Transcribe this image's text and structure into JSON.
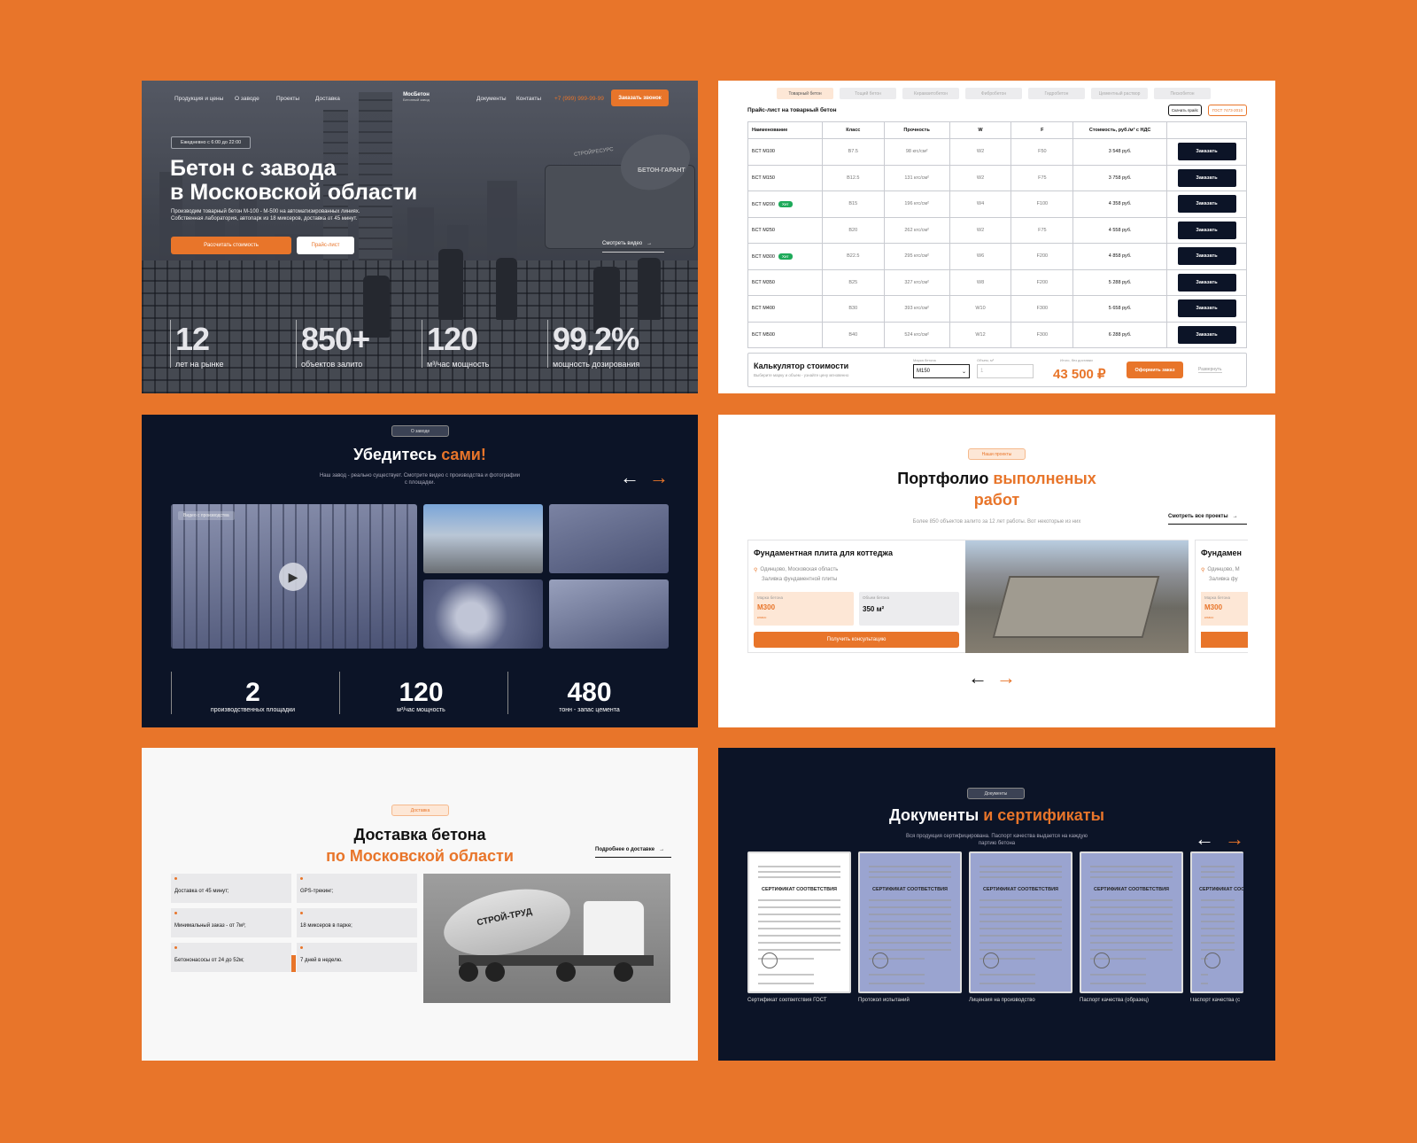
{
  "hero": {
    "nav": [
      "Продукция и цены",
      "О заводе",
      "Проекты",
      "Доставка",
      "Документы",
      "Контакты"
    ],
    "logo": "МосБетон",
    "logo_sub": "Бетонный завод",
    "phone": "+7 (999) 999-99-99",
    "callback": "Заказать звонок",
    "hours": "Ежедневно с 6:00 до 22:00",
    "title1": "Бетон с завода",
    "title2": "в Московской области",
    "desc1": "Производим товарный бетон М-100 - М-500 на автоматизированных линиях.",
    "desc2": "Собственная лаборатория, автопарк из 18 миксеров, доставка от 45 минут.",
    "btn_calc": "Рассчитать стоимость",
    "btn_price": "Прайс-лист",
    "video": "Смотреть видео",
    "truck_brand": "БЕТОН-ГАРАНТ",
    "truck_brand2": "СТРОЙРЕСУРС",
    "stats": [
      {
        "num": "12",
        "label": "лет на рынке"
      },
      {
        "num": "850+",
        "label": "объектов залито"
      },
      {
        "num": "120",
        "label": "м³/час мощность"
      },
      {
        "num": "99,2%",
        "label": "мощность дозирования"
      }
    ]
  },
  "price": {
    "tabs": [
      "Товарный бетон",
      "Тощий бетон",
      "Керамзитобетон",
      "Фибробетон",
      "Гидробетон",
      "Цементный раствор",
      "Пескобетон"
    ],
    "title": "Прайс-лист на товарный бетон",
    "download": "Скачать прайс",
    "gost": "ГОСТ 7473-2010",
    "headers": [
      "Наименование",
      "Класс",
      "Прочность",
      "W",
      "F",
      "Стоимость, руб./м³ с НДС"
    ],
    "order": "Заказать",
    "hit": "Хит",
    "rows": [
      [
        "БСТ М100",
        "B7.5",
        "98 кгс/см²",
        "W2",
        "F50",
        "3 548 руб.",
        false
      ],
      [
        "БСТ М150",
        "B12.5",
        "131 кгс/см²",
        "W2",
        "F75",
        "3 758 руб.",
        false
      ],
      [
        "БСТ М200",
        "B15",
        "196 кгс/см²",
        "W4",
        "F100",
        "4 358 руб.",
        true
      ],
      [
        "БСТ М250",
        "B20",
        "262 кгс/см²",
        "W2",
        "F75",
        "4 558 руб.",
        false
      ],
      [
        "БСТ М300",
        "B22.5",
        "295 кгс/см²",
        "W6",
        "F200",
        "4 858 руб.",
        true
      ],
      [
        "БСТ М350",
        "B25",
        "327 кгс/см²",
        "W8",
        "F200",
        "5 288 руб.",
        false
      ],
      [
        "БСТ М400",
        "B30",
        "393 кгс/см²",
        "W10",
        "F300",
        "5 658 руб.",
        false
      ],
      [
        "БСТ М500",
        "B40",
        "524 кгс/см²",
        "W12",
        "F300",
        "6 288 руб.",
        false
      ]
    ],
    "calc": {
      "title": "Калькулятор стоимости",
      "sub": "Выберите марку и объем - узнайте цену мгновенно",
      "brand_label": "Марка бетона",
      "brand_value": "М150",
      "vol_label": "Объем, м³",
      "vol_value": "1",
      "total_label": "Итого, без доставки",
      "total": "43 500 ₽",
      "order": "Оформить заказ",
      "expand": "Развернуть"
    }
  },
  "about": {
    "badge": "О заводе",
    "title1": "Убедитесь ",
    "title2": "сами!",
    "desc1": "Наш завод - реально существует. Смотрите видео с производства и фотографии",
    "desc2": "с площадки.",
    "video_tag": "Видео с производства",
    "stats": [
      {
        "num": "2",
        "label": "производственных площадки"
      },
      {
        "num": "120",
        "label": "м³/час мощность"
      },
      {
        "num": "480",
        "label": "тонн - запас цемента"
      }
    ]
  },
  "portfolio": {
    "badge": "Наши проекты",
    "title1": "Портфолио ",
    "title2": "выполненых",
    "title3": "работ",
    "desc": "Более 850 объектов залито за 12 лет работы. Вот некоторые из них",
    "all": "Смотреть все проекты",
    "card": {
      "title": "Фундаментная плита для коттеджа",
      "place": "Одинцово, Московская область",
      "type": "Заливка фундаментной плиты",
      "brand_label": "Марка бетона",
      "brand": "М300",
      "brand_note": "класс",
      "vol_label": "Объем бетона",
      "vol": "350 м²",
      "btn": "Получить консультацию"
    },
    "card2": {
      "title": "Фундамен",
      "place": "Одинцово, М",
      "type": "Заливка фу",
      "brand_label": "Марка бетона",
      "brand": "М300",
      "brand_note": "класс"
    }
  },
  "delivery": {
    "badge": "Доставка",
    "title1": "Доставка бетона",
    "title2": "по Московской области",
    "more": "Подробнее о доставке",
    "features": [
      "Доставка от 45 минут;",
      "GPS-трекинг;",
      "Минимальный заказ - от 7м³;",
      "18 миксеров в парке;",
      "Бетононасосы от 24 до 52м;",
      "7 дней в неделю."
    ],
    "truck_text": "СТРОЙ-ТРУД"
  },
  "docs": {
    "badge": "Документы",
    "title1": "Документы ",
    "title2": "и сертификаты",
    "desc1": "Вся продукция сертифицирована. Паспорт качества выдается на каждую",
    "desc2": "партию бетона",
    "cert_title": "СЕРТИФИКАТ СООТВЕТСТВИЯ",
    "items": [
      "Сертификат соответствия ГОСТ",
      "Протокол испытаний",
      "Лицензия на производство",
      "Паспорт качества (образец)",
      "Паспорт качества (с"
    ]
  },
  "colors": {
    "accent": "#e8752a",
    "navy": "#0c1427",
    "bg": "#e8752a"
  },
  "icons": [
    "arrow-left-icon",
    "arrow-right-icon",
    "play-icon",
    "location-pin-icon",
    "chevron-down-icon"
  ]
}
